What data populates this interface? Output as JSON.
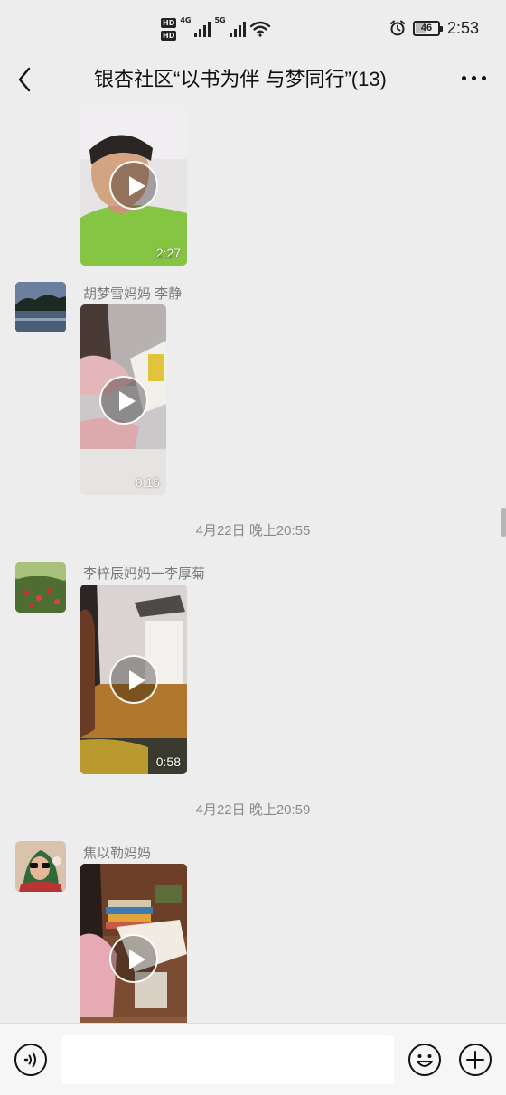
{
  "status_bar": {
    "hd_top": "HD",
    "hd_bottom": "HD",
    "sim1_network": "4G",
    "sim2_network": "5G",
    "battery": "46",
    "battery_level_percent": 46,
    "time": "2:53",
    "icons": [
      "alarm-icon",
      "wifi-icon",
      "signal-icon"
    ]
  },
  "header": {
    "back_icon": "chevron-left-icon",
    "title": "银杏社区“以书为伴 与梦同行”(13)",
    "more_icon": "more-dots-icon"
  },
  "messages": [
    {
      "sender": "",
      "video_duration": "2:27"
    },
    {
      "sender": "胡梦雪妈妈  李静",
      "video_duration": "0:15"
    },
    {
      "timestamp": "4月22日 晚上20:55"
    },
    {
      "sender": "李梓辰妈妈一李厚菊",
      "video_duration": "0:58"
    },
    {
      "timestamp": "4月22日 晚上20:59"
    },
    {
      "sender": "焦以勒妈妈",
      "video_duration": ""
    }
  ],
  "input_bar": {
    "voice_icon": "voice-icon",
    "input_value": "",
    "emoji_icon": "emoji-icon",
    "plus_icon": "plus-icon"
  },
  "colors": {
    "background": "#ededed",
    "input_bar": "#f6f6f6",
    "sender_name": "#7b7b7b",
    "timestamp": "#8a8a8a"
  }
}
